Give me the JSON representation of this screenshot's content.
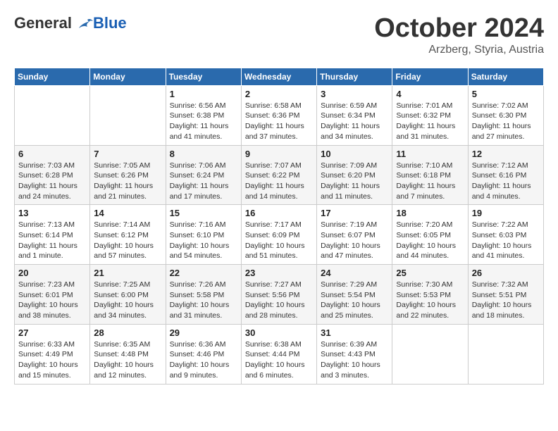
{
  "header": {
    "logo_general": "General",
    "logo_blue": "Blue",
    "month": "October 2024",
    "location": "Arzberg, Styria, Austria"
  },
  "weekdays": [
    "Sunday",
    "Monday",
    "Tuesday",
    "Wednesday",
    "Thursday",
    "Friday",
    "Saturday"
  ],
  "weeks": [
    [
      {
        "day": "",
        "info": ""
      },
      {
        "day": "",
        "info": ""
      },
      {
        "day": "1",
        "info": "Sunrise: 6:56 AM\nSunset: 6:38 PM\nDaylight: 11 hours and 41 minutes."
      },
      {
        "day": "2",
        "info": "Sunrise: 6:58 AM\nSunset: 6:36 PM\nDaylight: 11 hours and 37 minutes."
      },
      {
        "day": "3",
        "info": "Sunrise: 6:59 AM\nSunset: 6:34 PM\nDaylight: 11 hours and 34 minutes."
      },
      {
        "day": "4",
        "info": "Sunrise: 7:01 AM\nSunset: 6:32 PM\nDaylight: 11 hours and 31 minutes."
      },
      {
        "day": "5",
        "info": "Sunrise: 7:02 AM\nSunset: 6:30 PM\nDaylight: 11 hours and 27 minutes."
      }
    ],
    [
      {
        "day": "6",
        "info": "Sunrise: 7:03 AM\nSunset: 6:28 PM\nDaylight: 11 hours and 24 minutes."
      },
      {
        "day": "7",
        "info": "Sunrise: 7:05 AM\nSunset: 6:26 PM\nDaylight: 11 hours and 21 minutes."
      },
      {
        "day": "8",
        "info": "Sunrise: 7:06 AM\nSunset: 6:24 PM\nDaylight: 11 hours and 17 minutes."
      },
      {
        "day": "9",
        "info": "Sunrise: 7:07 AM\nSunset: 6:22 PM\nDaylight: 11 hours and 14 minutes."
      },
      {
        "day": "10",
        "info": "Sunrise: 7:09 AM\nSunset: 6:20 PM\nDaylight: 11 hours and 11 minutes."
      },
      {
        "day": "11",
        "info": "Sunrise: 7:10 AM\nSunset: 6:18 PM\nDaylight: 11 hours and 7 minutes."
      },
      {
        "day": "12",
        "info": "Sunrise: 7:12 AM\nSunset: 6:16 PM\nDaylight: 11 hours and 4 minutes."
      }
    ],
    [
      {
        "day": "13",
        "info": "Sunrise: 7:13 AM\nSunset: 6:14 PM\nDaylight: 11 hours and 1 minute."
      },
      {
        "day": "14",
        "info": "Sunrise: 7:14 AM\nSunset: 6:12 PM\nDaylight: 10 hours and 57 minutes."
      },
      {
        "day": "15",
        "info": "Sunrise: 7:16 AM\nSunset: 6:10 PM\nDaylight: 10 hours and 54 minutes."
      },
      {
        "day": "16",
        "info": "Sunrise: 7:17 AM\nSunset: 6:09 PM\nDaylight: 10 hours and 51 minutes."
      },
      {
        "day": "17",
        "info": "Sunrise: 7:19 AM\nSunset: 6:07 PM\nDaylight: 10 hours and 47 minutes."
      },
      {
        "day": "18",
        "info": "Sunrise: 7:20 AM\nSunset: 6:05 PM\nDaylight: 10 hours and 44 minutes."
      },
      {
        "day": "19",
        "info": "Sunrise: 7:22 AM\nSunset: 6:03 PM\nDaylight: 10 hours and 41 minutes."
      }
    ],
    [
      {
        "day": "20",
        "info": "Sunrise: 7:23 AM\nSunset: 6:01 PM\nDaylight: 10 hours and 38 minutes."
      },
      {
        "day": "21",
        "info": "Sunrise: 7:25 AM\nSunset: 6:00 PM\nDaylight: 10 hours and 34 minutes."
      },
      {
        "day": "22",
        "info": "Sunrise: 7:26 AM\nSunset: 5:58 PM\nDaylight: 10 hours and 31 minutes."
      },
      {
        "day": "23",
        "info": "Sunrise: 7:27 AM\nSunset: 5:56 PM\nDaylight: 10 hours and 28 minutes."
      },
      {
        "day": "24",
        "info": "Sunrise: 7:29 AM\nSunset: 5:54 PM\nDaylight: 10 hours and 25 minutes."
      },
      {
        "day": "25",
        "info": "Sunrise: 7:30 AM\nSunset: 5:53 PM\nDaylight: 10 hours and 22 minutes."
      },
      {
        "day": "26",
        "info": "Sunrise: 7:32 AM\nSunset: 5:51 PM\nDaylight: 10 hours and 18 minutes."
      }
    ],
    [
      {
        "day": "27",
        "info": "Sunrise: 6:33 AM\nSunset: 4:49 PM\nDaylight: 10 hours and 15 minutes."
      },
      {
        "day": "28",
        "info": "Sunrise: 6:35 AM\nSunset: 4:48 PM\nDaylight: 10 hours and 12 minutes."
      },
      {
        "day": "29",
        "info": "Sunrise: 6:36 AM\nSunset: 4:46 PM\nDaylight: 10 hours and 9 minutes."
      },
      {
        "day": "30",
        "info": "Sunrise: 6:38 AM\nSunset: 4:44 PM\nDaylight: 10 hours and 6 minutes."
      },
      {
        "day": "31",
        "info": "Sunrise: 6:39 AM\nSunset: 4:43 PM\nDaylight: 10 hours and 3 minutes."
      },
      {
        "day": "",
        "info": ""
      },
      {
        "day": "",
        "info": ""
      }
    ]
  ]
}
